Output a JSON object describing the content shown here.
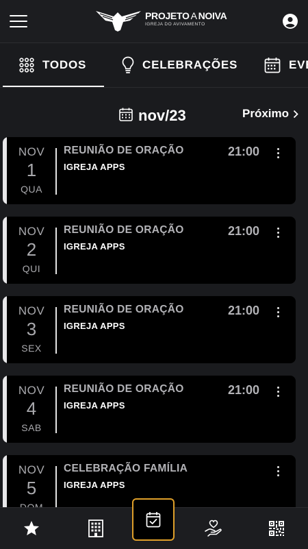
{
  "header": {
    "logo_title_bold": "PROJETO",
    "logo_title_thin": "A",
    "logo_title_end": "NOIVA",
    "logo_subtitle": "IGREJA DO AVIVAMENTO"
  },
  "tabs": [
    {
      "label": "TODOS",
      "icon": "grid-dots-icon",
      "active": true
    },
    {
      "label": "CELEBRAÇÕES",
      "icon": "lightbulb-icon",
      "active": false
    },
    {
      "label": "EVENTOS",
      "icon": "calendar-icon",
      "active": false
    }
  ],
  "month_nav": {
    "month": "nov/23",
    "next_label": "Próximo"
  },
  "events": [
    {
      "month": "NOV",
      "day": "1",
      "weekday": "QUA",
      "title": "REUNIÃO DE ORAÇÃO",
      "church": "IGREJA APPS",
      "time": "21:00"
    },
    {
      "month": "NOV",
      "day": "2",
      "weekday": "QUI",
      "title": "REUNIÃO DE ORAÇÃO",
      "church": "IGREJA APPS",
      "time": "21:00"
    },
    {
      "month": "NOV",
      "day": "3",
      "weekday": "SEX",
      "title": "REUNIÃO DE ORAÇÃO",
      "church": "IGREJA APPS",
      "time": "21:00"
    },
    {
      "month": "NOV",
      "day": "4",
      "weekday": "SAB",
      "title": "REUNIÃO DE ORAÇÃO",
      "church": "IGREJA APPS",
      "time": "21:00"
    },
    {
      "month": "NOV",
      "day": "5",
      "weekday": "DOM",
      "title": "CELEBRAÇÃO FAMÍLIA",
      "church": "IGREJA APPS",
      "time": ""
    }
  ],
  "bottom_nav": [
    {
      "icon": "star-icon",
      "active": false
    },
    {
      "icon": "building-icon",
      "active": false
    },
    {
      "icon": "calendar-check-icon",
      "active": true
    },
    {
      "icon": "hand-heart-icon",
      "active": false
    },
    {
      "icon": "qr-code-icon",
      "active": false
    }
  ],
  "colors": {
    "background": "#1a1b1e",
    "card": "#000000",
    "muted_text": "#b3b3b7",
    "active_nav_border": "#e0a02a"
  }
}
